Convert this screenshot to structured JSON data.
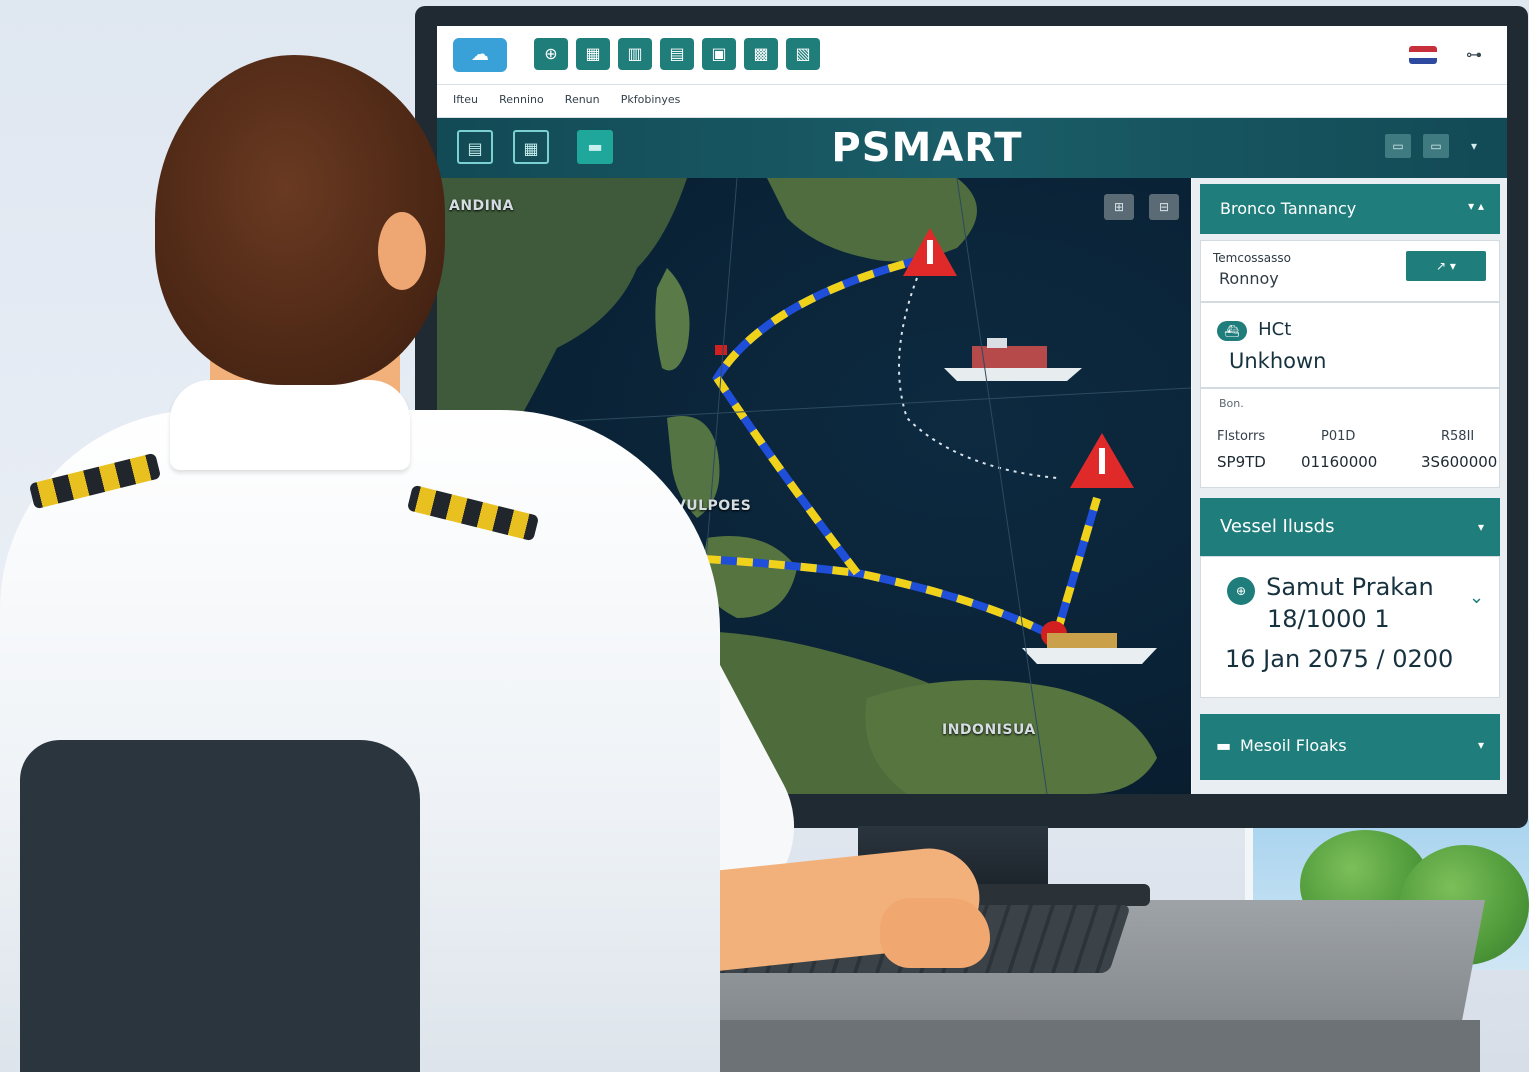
{
  "app": {
    "title": "PSMART"
  },
  "toolbar": {
    "logo_icon": "cloud-icon",
    "buttons": [
      {
        "icon": "globe-icon",
        "glyph": "⊕"
      },
      {
        "icon": "calendar-icon",
        "glyph": "▦"
      },
      {
        "icon": "grid-icon",
        "glyph": "▥"
      },
      {
        "icon": "document-icon",
        "glyph": "▤"
      },
      {
        "icon": "clipboard-icon",
        "glyph": "▣"
      },
      {
        "icon": "save-icon",
        "glyph": "▩"
      },
      {
        "icon": "archive-icon",
        "glyph": "▧"
      }
    ],
    "flag_icon": "flag-icon",
    "profile_icon": "user-menu-icon",
    "profile_glyph": "⊶"
  },
  "menu": {
    "items": [
      "Ifteu",
      "Rennino",
      "Renun",
      "Pkfobinyes"
    ]
  },
  "titlebar": {
    "left_icons": [
      {
        "icon": "map-layer-icon",
        "glyph": "▤"
      },
      {
        "icon": "table-icon",
        "glyph": "▦"
      },
      {
        "icon": "folder-icon",
        "glyph": "▬"
      }
    ],
    "right_icons": [
      {
        "icon": "window-icon",
        "glyph": "▭"
      },
      {
        "icon": "window-icon",
        "glyph": "▭"
      }
    ],
    "chevron": "▾"
  },
  "map": {
    "labels": {
      "top_left": "ANDINA",
      "middle": "PAVULPOES",
      "bottom": "INDONISUA"
    },
    "controls": [
      "⊞",
      "⊟"
    ],
    "alert_icon": "warning-triangle-icon",
    "ship_icon": "ship-icon",
    "colors": {
      "route_blue": "#1f4fd8",
      "route_yellow": "#f1d21b",
      "alert_red": "#e02a2a"
    }
  },
  "panel": {
    "header1": {
      "label": "Bronco Tannancy",
      "chevron": "▾ ▴"
    },
    "route": {
      "label_top": "Temcossasso",
      "label_bottom": "Ronnoy",
      "button": "↗ ▾"
    },
    "status": {
      "icon": "ship-badge-icon",
      "code": "HCt",
      "value": "Unkhown"
    },
    "table": {
      "caption": "Bon.",
      "headers": [
        "Flstorrs",
        "P01D",
        "R58II"
      ],
      "values": [
        "SP9TD",
        "01160000",
        "3S600000"
      ]
    },
    "header2": {
      "label": "Vessel Ilusds",
      "chevron": "▾"
    },
    "vessel": {
      "icon": "port-icon",
      "name": "Samut Prakan",
      "ref": "18/1000  1",
      "time": "16  Jan  2075  /  0200",
      "chevron": "⌄"
    },
    "header3": {
      "icon": "briefcase-icon",
      "label": "Mesoil Floaks",
      "chevron": "▾"
    }
  }
}
